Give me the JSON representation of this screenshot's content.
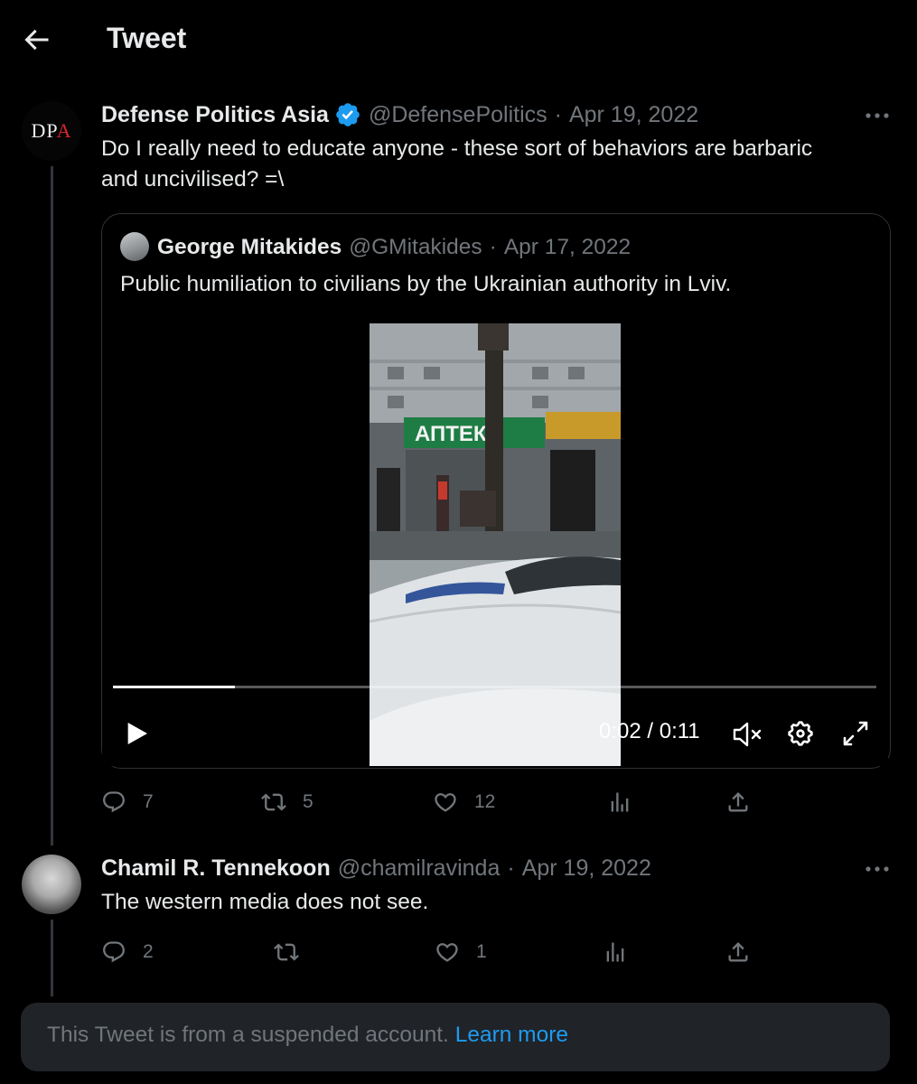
{
  "header": {
    "title": "Tweet"
  },
  "main_tweet": {
    "author_name": "Defense Politics Asia",
    "handle": "@DefensePolitics",
    "separator": "·",
    "date": "Apr 19, 2022",
    "text_line1": "Do I really need to educate anyone - these sort of behaviors are barbaric",
    "text_line2": "and uncivilised? =\\",
    "avatar_logo": {
      "part1": "DP",
      "part2": "A"
    },
    "quote": {
      "author_name": "George Mitakides",
      "handle": "@GMitakides",
      "separator": "·",
      "date": "Apr 17, 2022",
      "text": "Public humiliation to civilians by the Ukrainian authority in Lviv.",
      "video": {
        "sign_text": "АПТЕК",
        "time_display": "0:02 / 0:11",
        "progress": 0.16
      }
    },
    "actions": {
      "replies": "7",
      "retweets": "5",
      "likes": "12"
    }
  },
  "reply_tweet": {
    "author_name": "Chamil R. Tennekoon",
    "handle": "@chamilravinda",
    "separator": "·",
    "date": "Apr 19, 2022",
    "text": "The western media does not see.",
    "actions": {
      "replies": "2",
      "retweets": "",
      "likes": "1"
    }
  },
  "suspended_notice": {
    "text": "This Tweet is from a suspended account.",
    "link_text": "Learn more"
  },
  "colors": {
    "background": "#000000",
    "text_primary": "#e7e9ea",
    "text_secondary": "#71767b",
    "accent": "#1d9bf0",
    "border": "#2f3336",
    "notice_bg": "#202327"
  }
}
